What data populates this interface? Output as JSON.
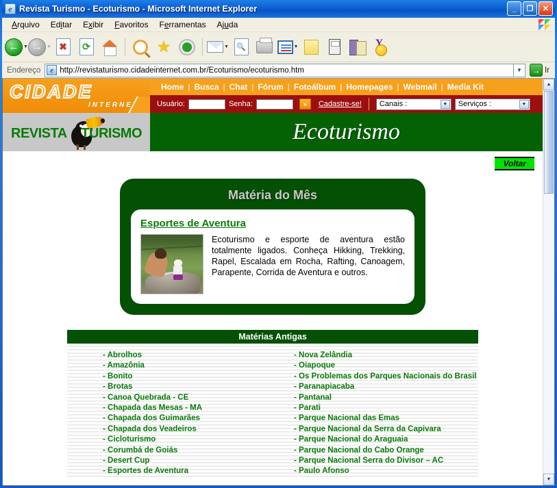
{
  "window": {
    "title": "Revista Turismo - Ecoturismo - Microsoft Internet Explorer",
    "minimize": "_",
    "maximize": "❐",
    "close": "✕"
  },
  "menu": [
    {
      "label": "Arquivo"
    },
    {
      "label": "Editar"
    },
    {
      "label": "Exibir"
    },
    {
      "label": "Favoritos"
    },
    {
      "label": "Ferramentas"
    },
    {
      "label": "Ajuda"
    }
  ],
  "toolbar": {
    "back": "Voltar",
    "forward": "Avançar",
    "stop": "Parar",
    "refresh": "Atualizar",
    "home": "Página inicial",
    "search": "Pesquisar",
    "favorites": "Favoritos",
    "history": "Histórico",
    "mail": "Email",
    "print_preview": "Visualizar impressão",
    "print": "Imprimir",
    "edit": "Editar",
    "notes": "Notas",
    "calculator": "Calculadora",
    "research": "Pesquisa",
    "messenger": "Yahoo! Messenger"
  },
  "address": {
    "label": "Endereço",
    "url": "http://revistaturismo.cidadeinternet.com.br/Ecoturismo/ecoturismo.htm",
    "go_label": "Ir"
  },
  "site": {
    "logo": "CIDADE",
    "logo_sub": "INTERNET",
    "nav": [
      "Home",
      "Busca",
      "Chat",
      "Fórum",
      "Fotoálbum",
      "Homepages",
      "Webmail",
      "Media Kit"
    ],
    "nav_separator": "|",
    "login": {
      "user_label": "Usuário:",
      "user_value": "",
      "pass_label": "Senha:",
      "pass_value": "",
      "submit_icon": "»",
      "register_link": "Cadastre-se!",
      "canais_label": "Canais :",
      "servicos_label": "Serviços :"
    },
    "banner": {
      "revista": "REVISTA",
      "turismo": "TURISMO",
      "section_title": "Ecoturismo"
    },
    "back_button": "Voltar"
  },
  "featured": {
    "heading": "Matéria do Mês",
    "link": "Esportes de Aventura",
    "text": "Ecoturismo e esporte de aventura estão totalmente ligados. Conheça Hikking, Trekking, Rapel, Escalada em Rocha, Rafting, Canoagem, Parapente, Corrida de Aventura e outros."
  },
  "archive": {
    "heading": "Matérias Antigas",
    "left": [
      "- Abrolhos",
      "- Amazônia",
      "- Bonito",
      "- Brotas",
      "- Canoa Quebrada - CE",
      "- Chapada das Mesas - MA",
      "- Chapada dos Guimarães",
      "- Chapada dos Veadeiros",
      "- Cicloturismo",
      "- Corumbá de Goiás",
      "- Desert Cup",
      "- Esportes de Aventura"
    ],
    "right": [
      "- Nova Zelândia",
      "- Oiapoque",
      "- Os Problemas dos Parques Nacionais do Brasil",
      "- Paranapiacaba",
      "- Pantanal",
      "- Parati",
      "- Parque Nacional das Emas",
      "- Parque Nacional da Serra da Capivara",
      "- Parque Nacional do Araguaia",
      "- Parque Nacional do Cabo Orange",
      "- Parque Nacional Serra do Divisor – AC",
      "- Paulo Afonso"
    ]
  },
  "colors": {
    "orange": "#f7a01c",
    "dark_red": "#9c0f0f",
    "green": "#046204",
    "link_green": "#0a7a0a"
  }
}
